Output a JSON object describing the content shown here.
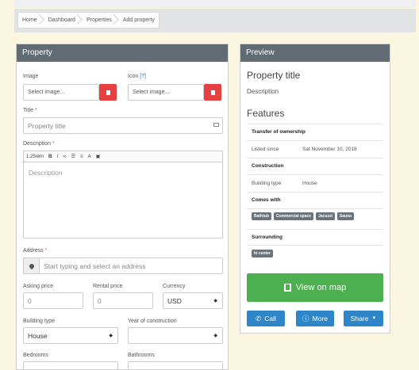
{
  "breadcrumb": [
    "Home",
    "Dashboard",
    "Properties",
    "Add property"
  ],
  "form": {
    "title": "Property",
    "image_label": "Image",
    "image_placeholder": "Select image...",
    "icon_label": "Icon",
    "icon_help": "[?]",
    "icon_placeholder": "Select image...",
    "title_label": "Title",
    "title_placeholder": "Property title",
    "description_label": "Description",
    "editor_font_size": "1.25rem",
    "editor_placeholder": "Description",
    "address_label": "Address",
    "address_placeholder": "Start typing and select an address",
    "asking_price_label": "Asking price",
    "asking_price_value": "0",
    "rental_price_label": "Rental price",
    "rental_price_value": "0",
    "currency_label": "Currency",
    "currency_value": "USD",
    "building_type_label": "Building type",
    "building_type_value": "House",
    "year_label": "Year of construction",
    "year_value": "",
    "bedrooms_label": "Bedrooms",
    "bathrooms_label": "Bathrooms",
    "required_mark": "*"
  },
  "preview": {
    "header": "Preview",
    "title": "Property title",
    "description": "Description",
    "features_heading": "Features",
    "sections": {
      "transfer": "Transfer of ownership",
      "listed_label": "Listed since",
      "listed_value": "Sat November 10, 2018",
      "construction": "Construction",
      "building_type_label": "Building type",
      "building_type_value": "House",
      "comes_with": "Comes with",
      "surrounding": "Surrounding"
    },
    "comes_with_tags": [
      "Bathtub",
      "Commercial space",
      "Jacuzzi",
      "Sauna"
    ],
    "surrounding_tags": [
      "In center"
    ],
    "view_on_map": "View on map",
    "call": "Call",
    "more": "More",
    "share": "Share"
  },
  "colors": {
    "panel_header": "#616b74",
    "danger": "#e64040",
    "success": "#4cb050",
    "primary": "#2e86c9",
    "page_bg": "#fbf6df"
  }
}
